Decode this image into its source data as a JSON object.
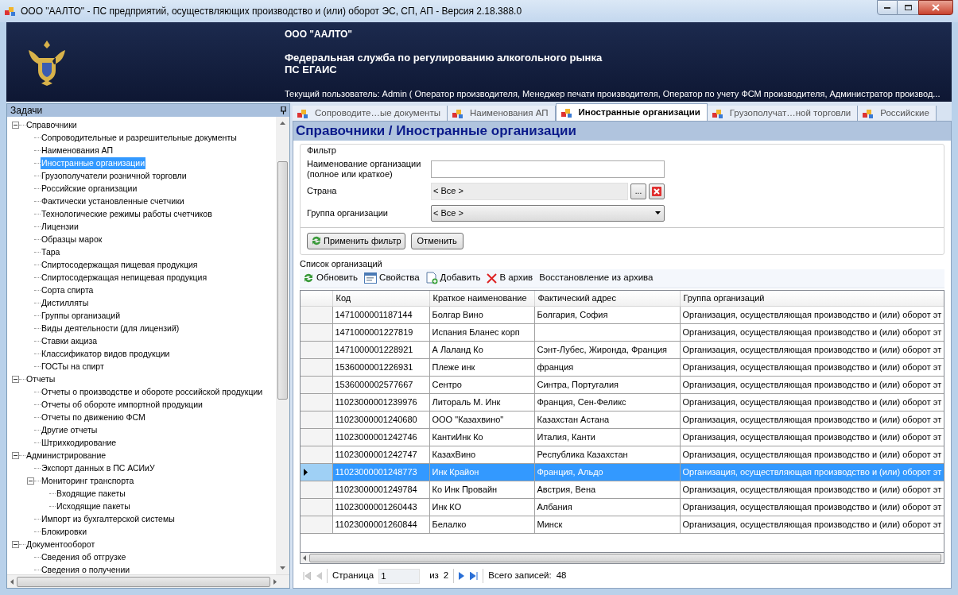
{
  "window": {
    "title": "ООО \"ААЛТО\" - ПС предприятий, осуществляющих производство и (или) оборот ЭС, СП, АП - Версия 2.18.388.0"
  },
  "header": {
    "company": "ООО \"ААЛТО\"",
    "agency": "Федеральная служба по регулированию алкогольного рынка",
    "system": "ПС ЕГАИС",
    "user": "Текущий пользователь: Admin ( Оператор производителя, Менеджер печати производителя, Оператор по учету ФСМ производителя, Администратор производ..."
  },
  "tasks_panel": {
    "title": "Задачи",
    "tree": [
      {
        "label": "Справочники",
        "expanded": true,
        "selected": false,
        "children": [
          {
            "label": "Сопроводительные и разрешительные документы",
            "selected": false
          },
          {
            "label": "Наименования АП",
            "selected": false
          },
          {
            "label": "Иностранные организации",
            "selected": true
          },
          {
            "label": "Грузополучатели розничной торговли",
            "selected": false
          },
          {
            "label": "Российские организации",
            "selected": false
          },
          {
            "label": "Фактически установленные счетчики",
            "selected": false
          },
          {
            "label": "Технологические режимы работы счетчиков",
            "selected": false
          },
          {
            "label": "Лицензии",
            "selected": false
          },
          {
            "label": "Образцы марок",
            "selected": false
          },
          {
            "label": "Тара",
            "selected": false
          },
          {
            "label": "Спиртосодержащая пищевая продукция",
            "selected": false
          },
          {
            "label": "Спиртосодержащая непищевая продукция",
            "selected": false
          },
          {
            "label": "Сорта спирта",
            "selected": false
          },
          {
            "label": "Дистилляты",
            "selected": false
          },
          {
            "label": "Группы организаций",
            "selected": false
          },
          {
            "label": "Виды деятельности (для лицензий)",
            "selected": false
          },
          {
            "label": "Ставки акциза",
            "selected": false
          },
          {
            "label": "Классификатор видов продукции",
            "selected": false
          },
          {
            "label": "ГОСТы на спирт",
            "selected": false
          }
        ]
      },
      {
        "label": "Отчеты",
        "expanded": true,
        "selected": false,
        "children": [
          {
            "label": "Отчеты о производстве и обороте российской продукции",
            "selected": false
          },
          {
            "label": "Отчеты об обороте импортной продукции",
            "selected": false
          },
          {
            "label": "Отчеты по движению ФСМ",
            "selected": false
          },
          {
            "label": "Другие отчеты",
            "selected": false
          },
          {
            "label": "Штрихкодирование",
            "selected": false
          }
        ]
      },
      {
        "label": "Администрирование",
        "expanded": true,
        "selected": false,
        "children": [
          {
            "label": "Экспорт данных в ПС АСИиУ",
            "selected": false
          },
          {
            "label": "Мониторинг транспорта",
            "expanded": true,
            "selected": false,
            "children": [
              {
                "label": "Входящие пакеты",
                "selected": false
              },
              {
                "label": "Исходящие пакеты",
                "selected": false
              }
            ]
          },
          {
            "label": "Импорт из бухгалтерской системы",
            "selected": false
          },
          {
            "label": "Блокировки",
            "selected": false
          }
        ]
      },
      {
        "label": "Документооборот",
        "expanded": true,
        "selected": false,
        "children": [
          {
            "label": "Сведения об отгрузке",
            "selected": false
          },
          {
            "label": "Сведения о получении",
            "selected": false
          }
        ]
      }
    ]
  },
  "tabs": [
    {
      "label": "Сопроводите…ые документы",
      "selected": false
    },
    {
      "label": "Наименования АП",
      "selected": false
    },
    {
      "label": "Иностранные организации",
      "selected": true
    },
    {
      "label": "Грузополучат…ной торговли",
      "selected": false
    },
    {
      "label": "Российские",
      "selected": false
    }
  ],
  "page_title": "Справочники / Иностранные организации",
  "filter": {
    "title": "Фильтр",
    "name_label": "Наименование организации\n(полное или краткое)",
    "country_label": "Страна",
    "country_value": "< Все >",
    "country_browse": "...",
    "group_label": "Группа организации",
    "group_value": "< Все >",
    "apply_button": "Применить фильтр",
    "cancel_button": "Отменить"
  },
  "list": {
    "title": "Список организаций",
    "toolbar": [
      {
        "kind": "refresh",
        "label": "Обновить"
      },
      {
        "kind": "properties",
        "label": "Свойства"
      },
      {
        "kind": "add",
        "label": "Добавить"
      },
      {
        "kind": "archive",
        "label": "В архив"
      },
      {
        "kind": "plain",
        "label": "Восстановление из архива"
      }
    ]
  },
  "table": {
    "columns": [
      "Код",
      "Краткое наименование",
      "Фактический адрес",
      "Группа организаций"
    ],
    "rows": [
      {
        "selected": false,
        "cells": [
          "1471000001187144",
          "Болгар Вино",
          "Болгария, София",
          "Организация, осуществляющая производство и (или) оборот эт"
        ]
      },
      {
        "selected": false,
        "cells": [
          "1471000001227819",
          "Испания Бланес корп",
          "",
          "Организация, осуществляющая производство и (или) оборот эт"
        ]
      },
      {
        "selected": false,
        "cells": [
          "1471000001228921",
          "А Лаланд  Ко",
          "Сэнт-Лубес, Жиронда, Франция",
          "Организация, осуществляющая производство и (или) оборот эт"
        ]
      },
      {
        "selected": false,
        "cells": [
          "1536000001226931",
          "Плеже инк",
          "франция",
          "Организация, осуществляющая производство и (или) оборот эт"
        ]
      },
      {
        "selected": false,
        "cells": [
          "1536000002577667",
          "Сентро",
          "Синтра, Португалия",
          "Организация, осуществляющая производство и (или) оборот эт"
        ]
      },
      {
        "selected": false,
        "cells": [
          "11023000001239976",
          "Литораль М. Инк",
          "Франция, Сен-Феликс",
          "Организация, осуществляющая производство и (или) оборот эт"
        ]
      },
      {
        "selected": false,
        "cells": [
          "11023000001240680",
          "ООО \"Казахвино\"",
          "Казахстан Астана",
          "Организация, осуществляющая производство и (или) оборот эт"
        ]
      },
      {
        "selected": false,
        "cells": [
          "11023000001242746",
          "КантиИнк Ко",
          "Италия, Канти",
          "Организация, осуществляющая производство и (или) оборот эт"
        ]
      },
      {
        "selected": false,
        "cells": [
          "11023000001242747",
          "КазахВино",
          "Республика Казахстан",
          "Организация, осуществляющая производство и (или) оборот эт"
        ]
      },
      {
        "selected": true,
        "cells": [
          "11023000001248773",
          "Инк Крайон",
          "Франция, Альдо",
          "Организация, осуществляющая производство и (или) оборот эт"
        ]
      },
      {
        "selected": false,
        "cells": [
          "11023000001249784",
          "Ко Инк Провайн",
          "Австрия, Вена",
          "Организация, осуществляющая производство и (или) оборот эт"
        ]
      },
      {
        "selected": false,
        "cells": [
          "11023000001260443",
          "Инк КО",
          "Албания",
          "Организация, осуществляющая производство и (или) оборот эт"
        ]
      },
      {
        "selected": false,
        "cells": [
          "11023000001260844",
          "Белалко",
          "Минск",
          "Организация, осуществляющая производство и (или) оборот эт"
        ]
      }
    ]
  },
  "pager": {
    "page_label": "Страница",
    "page": "1",
    "of_label": "из",
    "total_pages": "2",
    "records_label": "Всего записей:",
    "records": "48"
  }
}
